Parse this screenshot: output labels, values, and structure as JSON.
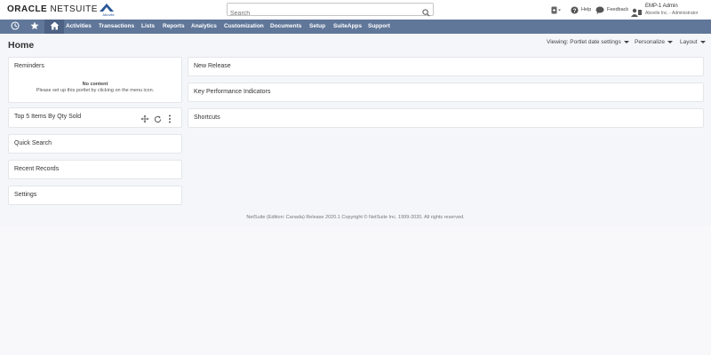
{
  "brand": {
    "oracle": "ORACLE",
    "netsuite": "NETSUITE",
    "company_logo_name": "Abovite",
    "brand_color": "#607799"
  },
  "search": {
    "placeholder": "Search"
  },
  "toolbar": {
    "help_label": "Help",
    "feedback_label": "Feedback"
  },
  "user": {
    "name": "EMP-1 Admin",
    "role": "Abovile Inc. - Administrator"
  },
  "nav": {
    "icons": [
      "history-icon",
      "star-icon",
      "home-icon"
    ],
    "items": [
      "Activities",
      "Transactions",
      "Lists",
      "Reports",
      "Analytics",
      "Customization",
      "Documents",
      "Setup",
      "SuiteApps",
      "Support"
    ]
  },
  "page": {
    "title": "Home",
    "viewing_label": "Viewing: Portlet date settings",
    "personalize_label": "Personalize",
    "layout_label": "Layout"
  },
  "portlets": {
    "reminders": {
      "title": "Reminders",
      "no_content": "No content",
      "hint": "Please set up this portlet by clicking on the menu icon."
    },
    "top5": {
      "title": "Top 5 Items By Qty Sold"
    },
    "quick_search": {
      "title": "Quick Search"
    },
    "recent_records": {
      "title": "Recent Records"
    },
    "settings": {
      "title": "Settings"
    },
    "new_release": {
      "title": "New Release"
    },
    "kpi": {
      "title": "Key Performance Indicators"
    },
    "shortcuts": {
      "title": "Shortcuts"
    }
  },
  "footer": {
    "text": "NetSuite (Edition: Canada) Release 2020.1 Copyright © NetSuite Inc. 1999-2020. All rights reserved."
  }
}
